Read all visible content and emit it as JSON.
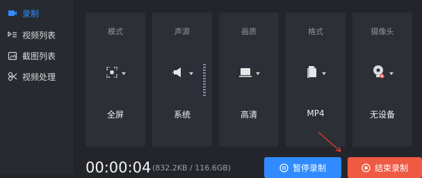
{
  "colors": {
    "accent": "#2e8cff",
    "pause": "#2f8bff",
    "stop": "#ee5a43",
    "arrow": "#e63b2e"
  },
  "sidebar": {
    "items": [
      {
        "label": "录制",
        "icon": "video-record-icon",
        "active": true
      },
      {
        "label": "视频列表",
        "icon": "video-list-icon",
        "active": false
      },
      {
        "label": "截图列表",
        "icon": "screenshot-list-icon",
        "active": false
      },
      {
        "label": "视频处理",
        "icon": "video-process-icon",
        "active": false
      }
    ]
  },
  "cards": [
    {
      "title": "模式",
      "value": "全屏",
      "icon": "fullscreen-select-icon"
    },
    {
      "title": "声源",
      "value": "系统",
      "icon": "speaker-icon"
    },
    {
      "title": "画质",
      "value": "高清",
      "icon": "monitor-icon"
    },
    {
      "title": "格式",
      "value": "MP4",
      "icon": "file-icon"
    },
    {
      "title": "摄像头",
      "value": "无设备",
      "icon": "webcam-icon"
    }
  ],
  "status": {
    "timer": "00:00:04",
    "size": "(832.2KB / 116.6GB)"
  },
  "buttons": {
    "pause": "暂停录制",
    "stop": "结束录制"
  }
}
